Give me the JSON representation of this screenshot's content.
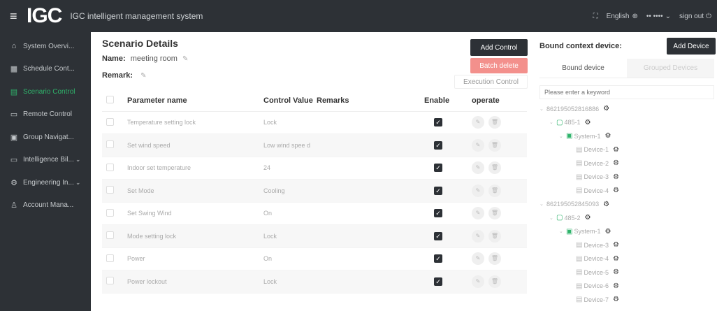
{
  "header": {
    "logo": "IGC",
    "title": "IGC intelligent management system",
    "language": "English",
    "username": "•• ••••",
    "signout": "sign out"
  },
  "sidebar": {
    "items": [
      {
        "label": "System Overvi...",
        "icon": "home-icon"
      },
      {
        "label": "Schedule Cont...",
        "icon": "calendar-icon"
      },
      {
        "label": "Scenario Control",
        "icon": "scenario-icon",
        "active": true
      },
      {
        "label": "Remote Control",
        "icon": "monitor-icon"
      },
      {
        "label": "Group Navigat...",
        "icon": "group-icon"
      },
      {
        "label": "Intelligence Bil...",
        "icon": "bill-icon",
        "caret": "⌄"
      },
      {
        "label": "Engineering In...",
        "icon": "engineering-icon",
        "caret": "⌄"
      },
      {
        "label": "Account Mana...",
        "icon": "user-icon"
      }
    ]
  },
  "main": {
    "title": "Scenario Details",
    "name_label": "Name:",
    "name_value": "meeting room",
    "remark_label": "Remark:",
    "add_control": "Add Control",
    "batch_delete": "Batch delete",
    "execution_control": "Execution Control",
    "columns": [
      "",
      "Parameter name",
      "Control Value",
      "Remarks",
      "Enable",
      "operate"
    ],
    "rows": [
      {
        "name": "Temperature setting lock",
        "value": "Lock",
        "remarks": "",
        "enabled": true
      },
      {
        "name": "Set wind speed",
        "value": "Low wind spee d",
        "remarks": "",
        "enabled": true
      },
      {
        "name": "Indoor set temperature",
        "value": "24",
        "remarks": "",
        "enabled": true
      },
      {
        "name": "Set Mode",
        "value": "Cooling",
        "remarks": "",
        "enabled": true
      },
      {
        "name": "Set Swing Wind",
        "value": "On",
        "remarks": "",
        "enabled": true
      },
      {
        "name": "Mode setting lock",
        "value": "Lock",
        "remarks": "",
        "enabled": true
      },
      {
        "name": "Power",
        "value": "On",
        "remarks": "",
        "enabled": true
      },
      {
        "name": "Power lockout",
        "value": "Lock",
        "remarks": "",
        "enabled": true
      }
    ]
  },
  "right": {
    "title": "Bound context device:",
    "add_device": "Add Device",
    "tabs": [
      "Bound device",
      "Grouped Devices"
    ],
    "search_placeholder": "Please enter a keyword",
    "tree": [
      {
        "label": "862195052816886",
        "level": 0,
        "arrow": "⌄",
        "icon": ""
      },
      {
        "label": "485-1",
        "level": 1,
        "arrow": "⌄",
        "icon": "bus"
      },
      {
        "label": "System-1",
        "level": 2,
        "arrow": "⌄",
        "icon": "sys"
      },
      {
        "label": "Device-1",
        "level": 3,
        "arrow": "",
        "icon": "dev"
      },
      {
        "label": "Device-2",
        "level": 3,
        "arrow": "",
        "icon": "dev"
      },
      {
        "label": "Device-3",
        "level": 3,
        "arrow": "",
        "icon": "dev"
      },
      {
        "label": "Device-4",
        "level": 3,
        "arrow": "",
        "icon": "dev"
      },
      {
        "label": "862195052845093",
        "level": 0,
        "arrow": "⌄",
        "icon": ""
      },
      {
        "label": "485-2",
        "level": 1,
        "arrow": "⌄",
        "icon": "bus"
      },
      {
        "label": "System-1",
        "level": 2,
        "arrow": "⌄",
        "icon": "sys"
      },
      {
        "label": "Device-3",
        "level": 3,
        "arrow": "",
        "icon": "dev"
      },
      {
        "label": "Device-4",
        "level": 3,
        "arrow": "",
        "icon": "dev"
      },
      {
        "label": "Device-5",
        "level": 3,
        "arrow": "",
        "icon": "dev"
      },
      {
        "label": "Device-6",
        "level": 3,
        "arrow": "",
        "icon": "dev"
      },
      {
        "label": "Device-7",
        "level": 3,
        "arrow": "",
        "icon": "dev"
      }
    ]
  },
  "colors": {
    "dark": "#2d3136",
    "accent_green": "#2fb36b",
    "danger": "#f3908c"
  }
}
